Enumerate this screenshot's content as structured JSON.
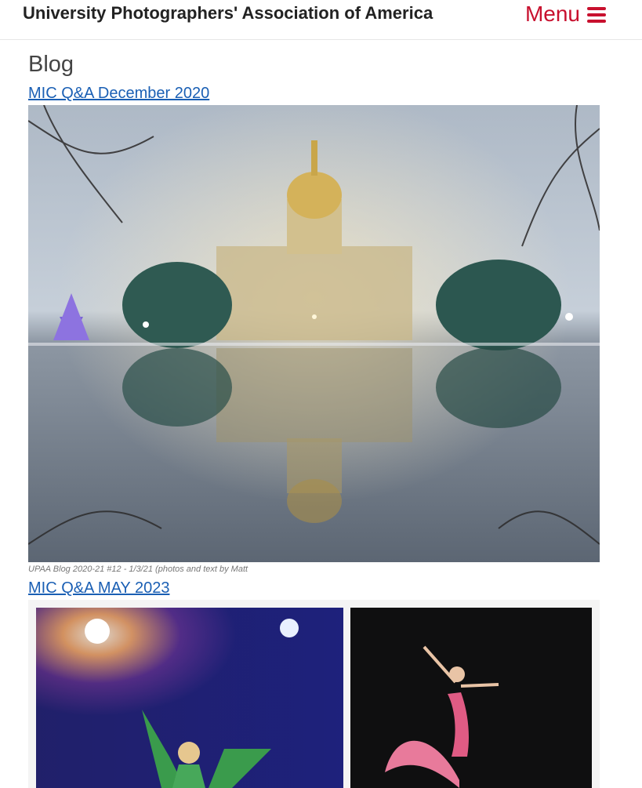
{
  "header": {
    "site_title": "University Photographers' Association of America",
    "menu_label": "Menu"
  },
  "page": {
    "title": "Blog"
  },
  "posts": [
    {
      "title": "MIC Q&A December 2020",
      "image_alt": "Foggy night view of a golden-domed building reflected in a puddle",
      "caption": "UPAA Blog 2020-21 #12 - 1/3/21 (photos and text by Matt"
    },
    {
      "title": "MIC Q&A MAY 2023",
      "image_alt": "Dancers on stage: a performer in green under blue stage lights and a ballerina in a pink dress"
    }
  ],
  "colors": {
    "accent": "#c8102e",
    "link": "#1a5fb4"
  }
}
